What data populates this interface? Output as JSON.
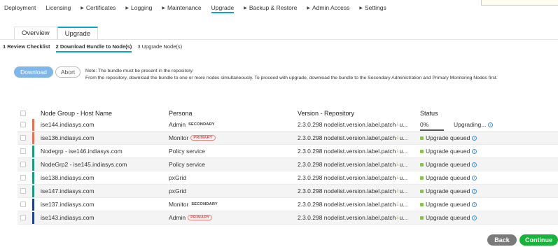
{
  "topnav": {
    "items": [
      {
        "label": "Deployment",
        "caret": false,
        "active": false
      },
      {
        "label": "Licensing",
        "caret": false,
        "active": false
      },
      {
        "label": "Certificates",
        "caret": true,
        "active": false
      },
      {
        "label": "Logging",
        "caret": true,
        "active": false
      },
      {
        "label": "Maintenance",
        "caret": true,
        "active": false
      },
      {
        "label": "Upgrade",
        "caret": false,
        "active": true
      },
      {
        "label": "Backup & Restore",
        "caret": true,
        "active": false
      },
      {
        "label": "Admin Access",
        "caret": true,
        "active": false
      },
      {
        "label": "Settings",
        "caret": true,
        "active": false
      }
    ]
  },
  "subtabs": {
    "overview": "Overview",
    "upgrade": "Upgrade"
  },
  "steps": {
    "step1_num": "1",
    "step1_label": "Review Checklist",
    "step2_num": "2",
    "step2_label": "Download Bundle to Node(s)",
    "step3_num": "3",
    "step3_label": "Upgrade Node(s)"
  },
  "actions": {
    "download": "Download",
    "abort": "Abort",
    "note_line1": "Note: The bundle must be present in the repository.",
    "note_line2": "From the repository, download the bundle to one or more nodes simultaneously. To proceed with upgrade, download the bundle to the Secondary Administration and Primary Monitoring Nodes first."
  },
  "table": {
    "headers": {
      "name": "Node Group - Host Name",
      "persona": "Persona",
      "version": "Version - Repository",
      "status": "Status"
    },
    "rows": [
      {
        "name": "ise144.indiasys.com",
        "persona": "Admin",
        "role": "SECONDARY",
        "role_style": "plain",
        "bar_color": "#e8705a",
        "version": "2.3.0.298 nodelist.version.label.patch",
        "version_suffix": "u...",
        "status": "Upgrading...",
        "progress": "0%"
      },
      {
        "name": "ise136.indiasys.com",
        "persona": "Monitor",
        "role": "PRIMARY",
        "role_style": "pill",
        "bar_color": "#e8705a",
        "version": "2.3.0.298 nodelist.version.label.patch",
        "version_suffix": "u...",
        "status": "Upgrade queued",
        "progress": ""
      },
      {
        "name": "Nodegrp - ise146.indiasys.com",
        "persona": "Policy service",
        "role": "",
        "role_style": "",
        "bar_color": "#1a9a7a",
        "version": "2.3.0.298 nodelist.version.label.patch",
        "version_suffix": "u...",
        "status": "Upgrade queued",
        "progress": ""
      },
      {
        "name": "NodeGrp2 - ise145.indiasys.com",
        "persona": "Policy service",
        "role": "",
        "role_style": "",
        "bar_color": "#1a9a7a",
        "version": "2.3.0.298 nodelist.version.label.patch",
        "version_suffix": "u...",
        "status": "Upgrade queued",
        "progress": ""
      },
      {
        "name": "ise138.indiasys.com",
        "persona": "pxGrid",
        "role": "",
        "role_style": "",
        "bar_color": "#1a9a7a",
        "version": "2.3.0.298 nodelist.version.label.patch",
        "version_suffix": "u...",
        "status": "Upgrade queued",
        "progress": ""
      },
      {
        "name": "ise147.indiasys.com",
        "persona": "pxGrid",
        "role": "",
        "role_style": "",
        "bar_color": "#1a9a7a",
        "version": "2.3.0.298 nodelist.version.label.patch",
        "version_suffix": "u...",
        "status": "Upgrade queued",
        "progress": ""
      },
      {
        "name": "ise137.indiasys.com",
        "persona": "Monitor",
        "role": "SECONDARY",
        "role_style": "plain",
        "bar_color": "#1f3f8f",
        "version": "2.3.0.298 nodelist.version.label.patch",
        "version_suffix": "u...",
        "status": "Upgrade queued",
        "progress": ""
      },
      {
        "name": "ise143.indiasys.com",
        "persona": "Admin",
        "role": "PRIMARY",
        "role_style": "pill",
        "bar_color": "#1f3f8f",
        "version": "2.3.0.298 nodelist.version.label.patch",
        "version_suffix": "u...",
        "status": "Upgrade queued",
        "progress": ""
      }
    ]
  },
  "footer": {
    "back": "Back",
    "continue": "Continue"
  },
  "icons": {
    "download": "download-icon",
    "info": "info-icon",
    "caret": "caret-right-icon"
  }
}
